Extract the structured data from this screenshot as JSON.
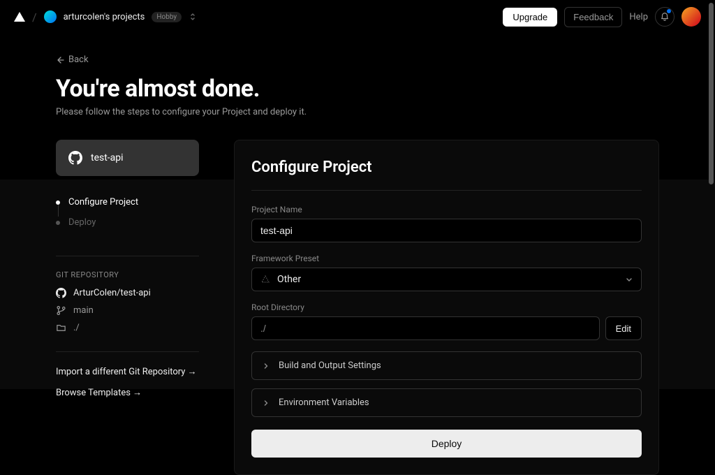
{
  "header": {
    "team_name": "arturcolen's projects",
    "plan_badge": "Hobby",
    "upgrade_label": "Upgrade",
    "feedback_label": "Feedback",
    "help_label": "Help"
  },
  "page": {
    "back_label": "Back",
    "title": "You're almost done.",
    "subtitle": "Please follow the steps to configure your Project and deploy it."
  },
  "repo_card": {
    "name": "test-api"
  },
  "steps": {
    "configure": "Configure Project",
    "deploy": "Deploy"
  },
  "git": {
    "section_label": "GIT REPOSITORY",
    "repo_full_name": "ArturColen/test-api",
    "branch": "main",
    "root": "./"
  },
  "sidebar_links": {
    "import_different": "Import a different Git Repository →",
    "browse_templates": "Browse Templates →"
  },
  "form": {
    "card_title": "Configure Project",
    "project_name_label": "Project Name",
    "project_name_value": "test-api",
    "framework_label": "Framework Preset",
    "framework_value": "Other",
    "root_dir_label": "Root Directory",
    "root_dir_value": "./",
    "edit_label": "Edit",
    "accordion_build": "Build and Output Settings",
    "accordion_env": "Environment Variables",
    "deploy_button": "Deploy"
  }
}
